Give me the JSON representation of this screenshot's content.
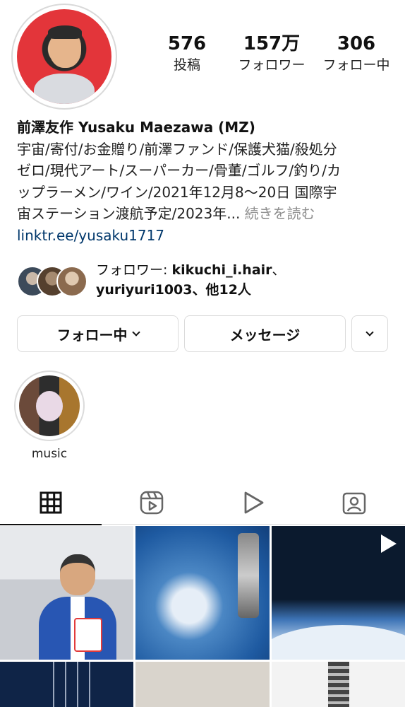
{
  "profile": {
    "stats": [
      {
        "value": "576",
        "label": "投稿"
      },
      {
        "value": "157万",
        "label": "フォロワー"
      },
      {
        "value": "306",
        "label": "フォロー中"
      }
    ],
    "name": "前澤友作 Yusaku Maezawa (MZ)",
    "bio_line1": "宇宙/寄付/お金贈り/前澤ファンド/保護犬猫/殺処分",
    "bio_line2": "ゼロ/現代アート/スーパーカー/骨董/ゴルフ/釣り/カ",
    "bio_line3": "ップラーメン/ワイン/2021年12月8〜20日 国際宇",
    "bio_line4": "宙ステーション渡航予定/2023年...",
    "more_label": "続きを読む",
    "link": "linktr.ee/yusaku1717"
  },
  "followed_by": {
    "prefix": "フォロワー: ",
    "user1": "kikuchi_i.hair",
    "separator": "、",
    "user2": "yuriyuri1003",
    "suffix": "、他12人"
  },
  "actions": {
    "follow_label": "フォロー中",
    "message_label": "メッセージ"
  },
  "highlights": [
    {
      "label": "music"
    }
  ],
  "tabs": [
    {
      "icon": "grid-icon",
      "active": true
    },
    {
      "icon": "reels-icon",
      "active": false
    },
    {
      "icon": "play-icon",
      "active": false
    },
    {
      "icon": "tagged-icon",
      "active": false
    }
  ]
}
